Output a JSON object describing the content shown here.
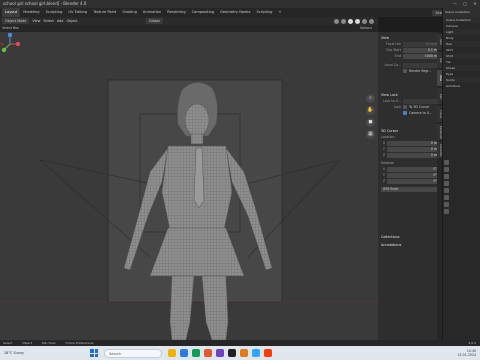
{
  "window": {
    "title": "school girl school girl.blend] - Blender 4.0",
    "controls": [
      "—",
      "□",
      "✕"
    ]
  },
  "menubar": {
    "tabs": [
      "Layout",
      "Modeling",
      "Sculpting",
      "UV Editing",
      "Texture Paint",
      "Shading",
      "Animation",
      "Rendering",
      "Compositing",
      "Geometry Nodes",
      "Scripting"
    ],
    "active_tab": "Layout",
    "add_tab": "+",
    "scene_label": "Scene",
    "view_layer_label": "ViewLayer"
  },
  "viewport_header": {
    "mode": "Object Mode",
    "menus": [
      "View",
      "Select",
      "Add",
      "Object"
    ],
    "orientation": "Global",
    "select_box": "Select Box",
    "options": "Options"
  },
  "sidebar_panel": {
    "view_section": {
      "title": "View",
      "rows": [
        {
          "label": "Focal Len",
          "value": "50 mm",
          "dim": true
        },
        {
          "label": "Clip Start",
          "value": "0.1 m",
          "dim": false
        },
        {
          "label": "End",
          "value": "1000 m",
          "dim": false
        }
      ],
      "local_camera_label": "Local Ca...",
      "render_region_label": "Render Regi..."
    },
    "view_lock_section": {
      "title": "View Lock",
      "lock_to_object_label": "Lock to O...",
      "lock_label": "Lock",
      "to_3d_cursor": "To 3D Cursor",
      "camera_to_view": "Camera to V..."
    },
    "cursor_section": {
      "title": "3D Cursor",
      "location_label": "Location",
      "location": [
        {
          "axis": "X",
          "value": "0 m"
        },
        {
          "axis": "Y",
          "value": "0 m"
        },
        {
          "axis": "Z",
          "value": "0 m"
        }
      ],
      "rotation_label": "Rotation",
      "rotation": [
        {
          "axis": "X",
          "value": "0°"
        },
        {
          "axis": "Y",
          "value": "0°"
        },
        {
          "axis": "Z",
          "value": "0°"
        }
      ],
      "rotation_mode": "XYZ Euler"
    },
    "collections_title": "Collections",
    "annotations_title": "Annotations",
    "vertical_tabs": [
      "Item",
      "Tool",
      "View",
      "Edit",
      "Create",
      "BlenderKit",
      "Animation"
    ]
  },
  "outliner": {
    "header": "Scene Collection",
    "rows": [
      "Scene Collection",
      "Camera",
      "Light",
      "Body",
      "Hair",
      "Skirt",
      "Shirt",
      "Tie",
      "Shoes",
      "Eyes",
      "Socks",
      "Armature"
    ]
  },
  "status": {
    "left": "Select",
    "middle": "Object",
    "popup": "Pan View",
    "right_label": "Follow Preferences",
    "version": "4.0.2"
  },
  "taskbar": {
    "weather": "28°C Sunny",
    "search_placeholder": "Search",
    "time": "12:45",
    "date": "15-01-2024",
    "app_colors": [
      "#f2b400",
      "#2c7be5",
      "#0f9d58",
      "#e2572c",
      "#6f42c1",
      "#212121",
      "#e5791b",
      "#31a8ff",
      "#ff3d00"
    ]
  },
  "colors": {
    "accent": "#4f7cc8",
    "gizmo_x": "#e5484d",
    "gizmo_y": "#6bbf3b",
    "gizmo_z": "#4c8ddb"
  }
}
